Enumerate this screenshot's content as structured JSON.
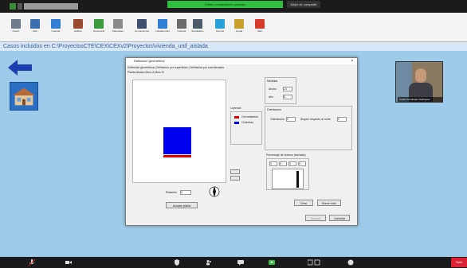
{
  "zoom": {
    "share_banner": "Estás compartiendo pantalla",
    "stop_share": "Dejar de compartir",
    "leave": "Salir"
  },
  "ribbon": {
    "tools": [
      {
        "label": "Nuevo",
        "color": "#6c7a8c"
      },
      {
        "label": "Abrir",
        "color": "#3a6fb0"
      },
      {
        "label": "Guardar",
        "color": "#2f7fd6"
      },
      {
        "label": "Edificio",
        "color": "#9c4a2f"
      },
      {
        "label": "Geometría",
        "color": "#3b9a3b"
      },
      {
        "label": "Materiales",
        "color": "#8a8a8a"
      },
      {
        "label": "Cerramientos",
        "color": "#3f4f6f"
      },
      {
        "label": "Instalaciones",
        "color": "#2f7fd6"
      },
      {
        "label": "Calcular",
        "color": "#6b6b6b"
      },
      {
        "label": "Resultados",
        "color": "#4b5b6b"
      },
      {
        "label": "Informe",
        "color": "#2aa0d8"
      },
      {
        "label": "Ayuda",
        "color": "#c8a02a"
      },
      {
        "label": "Salir",
        "color": "#d83a2a"
      }
    ]
  },
  "main": {
    "path": "Casos incluidos en C:\\ProyectosCTE\\CEX\\CEXv2\\Proyectos\\vivienda_unif_aislada"
  },
  "dialog": {
    "title": "Definición geométrica",
    "close": "×",
    "tabs": "Definición geométrica | Definición por superficies | Definición por coordenadas",
    "subtabs": "Planta   Alzado   Muro A   Muro B",
    "legend_title": "Leyenda",
    "legend_items": [
      {
        "label": "Cerramientos",
        "color": "#e00000"
      },
      {
        "label": "Cubiertas",
        "color": "#0000ee"
      }
    ],
    "dims_title": "Medidas",
    "dims": [
      {
        "label": "Ancho",
        "value": "10"
      },
      {
        "label": "Alto",
        "value": "5"
      }
    ],
    "orient_title": "Orientación",
    "orient_fields": [
      {
        "label": "Orientación",
        "value": "0"
      },
      {
        "label": "Ángulo respecto al norte",
        "value": "0"
      }
    ],
    "window_title": "Porcentaje de huecos (fachada)",
    "window_values": [
      "0",
      "0",
      "0",
      "0"
    ],
    "rotation_label": "Rotación",
    "rotation_value": "0",
    "bottom_btn": "Aceptar planta",
    "btn_left": "Crear",
    "btn_right": "Borrar todo",
    "ok": "Aceptar",
    "cancel": "Cancelar"
  },
  "webcam": {
    "name": "Carlos Fernández Rodríguez"
  }
}
